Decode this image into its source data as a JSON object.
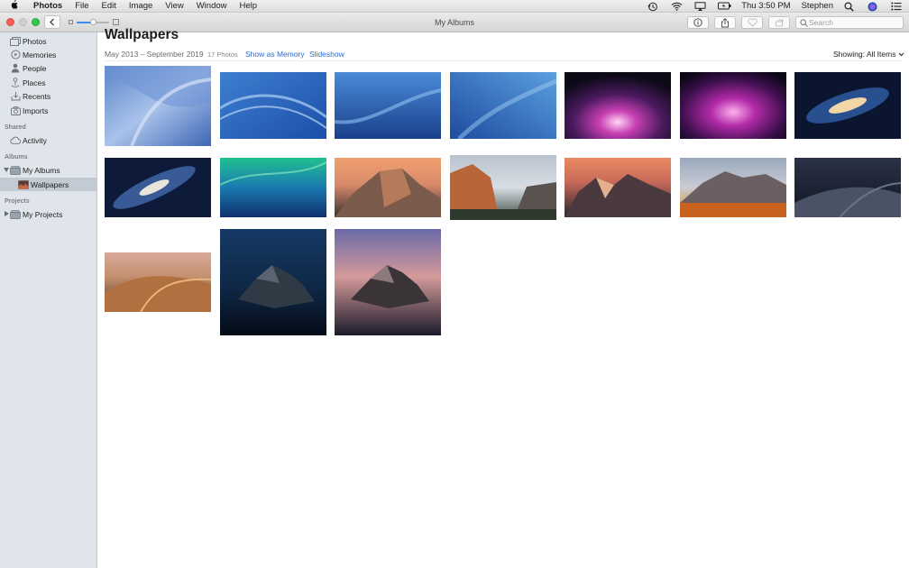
{
  "menubar": {
    "app_name": "Photos",
    "menus": [
      "File",
      "Edit",
      "Image",
      "View",
      "Window",
      "Help"
    ],
    "clock": "Thu 3:50 PM",
    "user": "Stephen"
  },
  "toolbar": {
    "window_title": "My Albums",
    "search_placeholder": "Search"
  },
  "sidebar": {
    "library_items": [
      {
        "label": "Photos",
        "icon": "photos-icon"
      },
      {
        "label": "Memories",
        "icon": "memories-icon"
      },
      {
        "label": "People",
        "icon": "people-icon"
      },
      {
        "label": "Places",
        "icon": "places-icon"
      },
      {
        "label": "Recents",
        "icon": "recents-icon"
      },
      {
        "label": "Imports",
        "icon": "imports-icon"
      }
    ],
    "shared_heading": "Shared",
    "activity": "Activity",
    "albums_heading": "Albums",
    "my_albums": "My Albums",
    "wallpapers": "Wallpapers",
    "projects_heading": "Projects",
    "my_projects": "My Projects"
  },
  "album": {
    "title": "Wallpapers",
    "date_range": "May 2013 – September 2019",
    "photo_count": "17 Photos",
    "show_as_memory": "Show as Memory",
    "slideshow": "Slideshow",
    "showing_label": "Showing:",
    "showing_value": "All Items"
  },
  "photos": [
    {
      "name": "blue-abstract-1"
    },
    {
      "name": "blue-waves-2"
    },
    {
      "name": "blue-wave-3"
    },
    {
      "name": "blue-wave-4"
    },
    {
      "name": "purple-aurora-1"
    },
    {
      "name": "purple-aurora-2"
    },
    {
      "name": "andromeda-galaxy-1"
    },
    {
      "name": "andromeda-galaxy-2"
    },
    {
      "name": "green-wave"
    },
    {
      "name": "yosemite-half-dome"
    },
    {
      "name": "el-capitan"
    },
    {
      "name": "sierra-peaks"
    },
    {
      "name": "high-sierra"
    },
    {
      "name": "mojave-night"
    },
    {
      "name": "mojave-day"
    },
    {
      "name": "catalina-night"
    },
    {
      "name": "catalina-dusk"
    }
  ],
  "colors": {
    "accent": "#2a6ad6",
    "sidebar_bg": "#e0e5eb",
    "selection": "#c2cad3"
  }
}
